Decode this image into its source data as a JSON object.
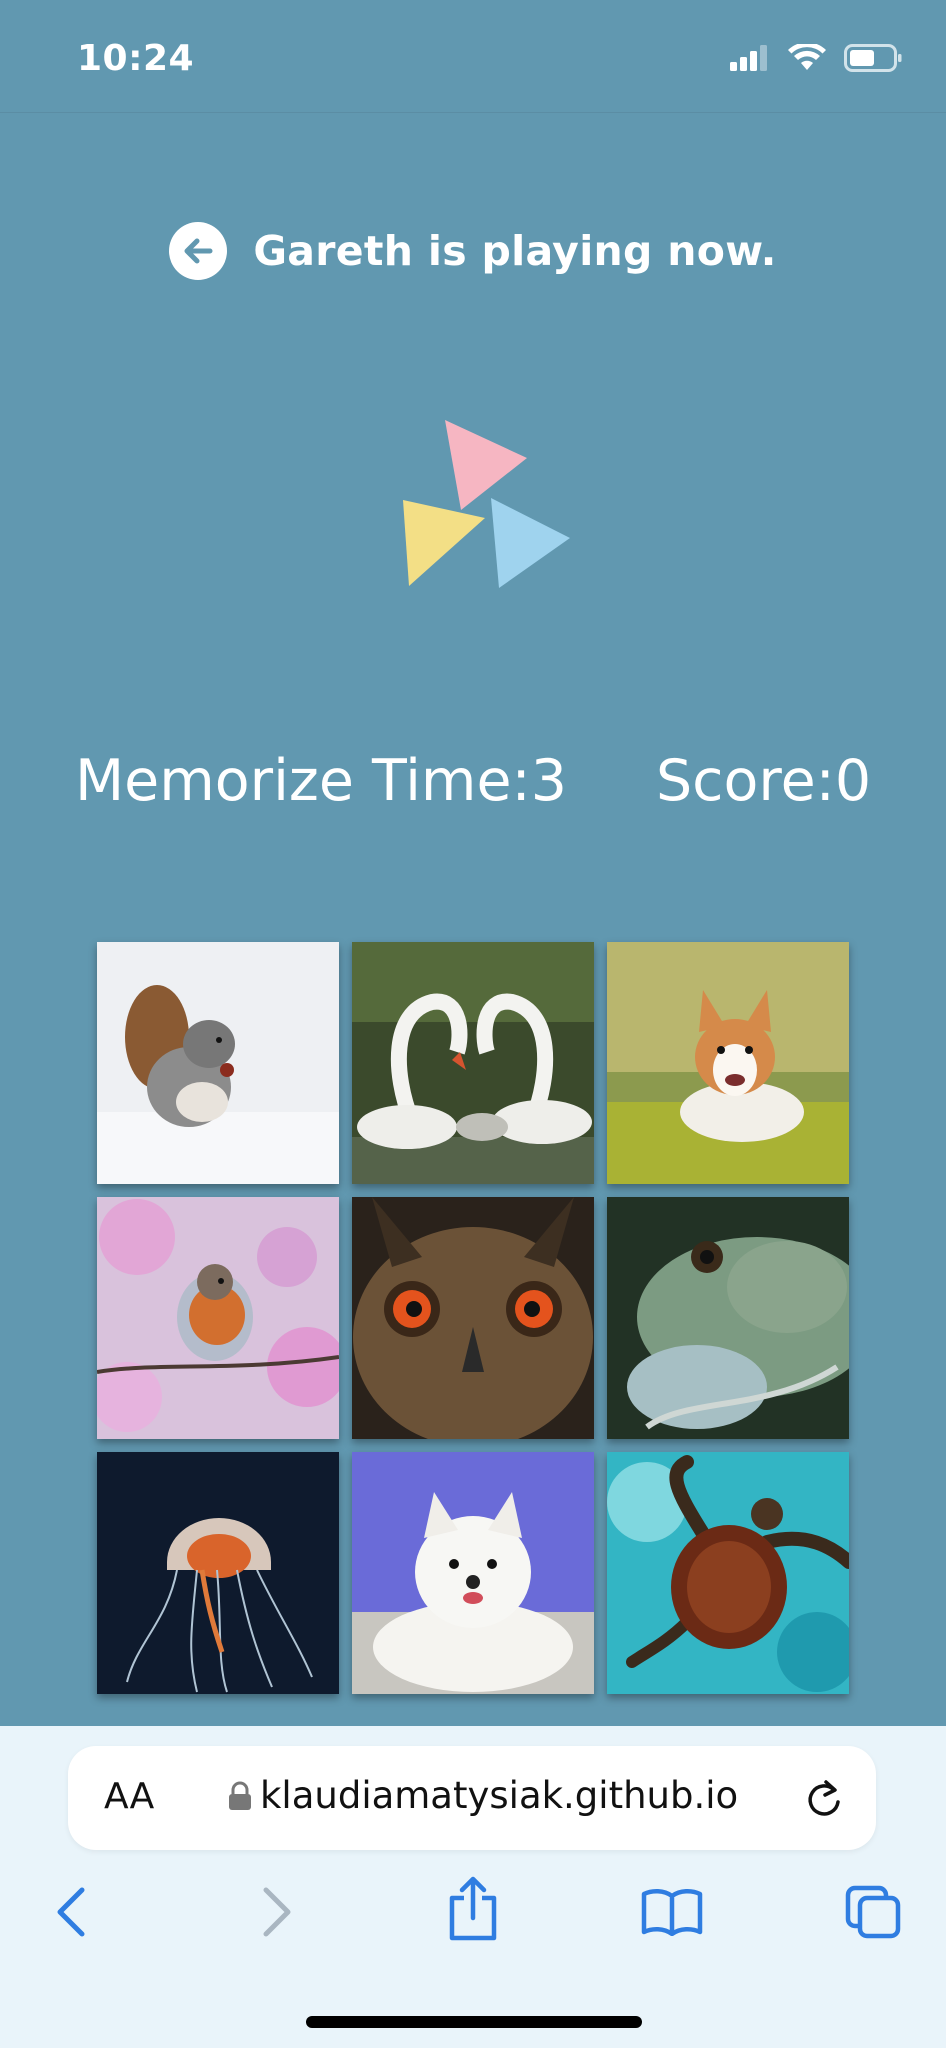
{
  "status": {
    "time": "10:24"
  },
  "header": {
    "title": "Gareth is playing now."
  },
  "stats": {
    "memorize_label": "Memorize Time:3",
    "score_label": "Score:0"
  },
  "grid": {
    "tiles": [
      {
        "icon": "squirrel-image"
      },
      {
        "icon": "swans-image"
      },
      {
        "icon": "corgi-image"
      },
      {
        "icon": "robin-image"
      },
      {
        "icon": "owl-image"
      },
      {
        "icon": "iguana-image"
      },
      {
        "icon": "jellyfish-image"
      },
      {
        "icon": "puppy-image"
      },
      {
        "icon": "turtle-image"
      }
    ]
  },
  "browser": {
    "aa_label": "AA",
    "url": "klaudiamatysiak.github.io"
  },
  "colors": {
    "background": "#6198b0",
    "logo_pink": "#f6b6c2",
    "logo_yellow": "#f3df86",
    "logo_blue": "#9fd3ee",
    "browser_bar": "#e9f4fa",
    "toolbar_blue": "#2f7de1"
  }
}
